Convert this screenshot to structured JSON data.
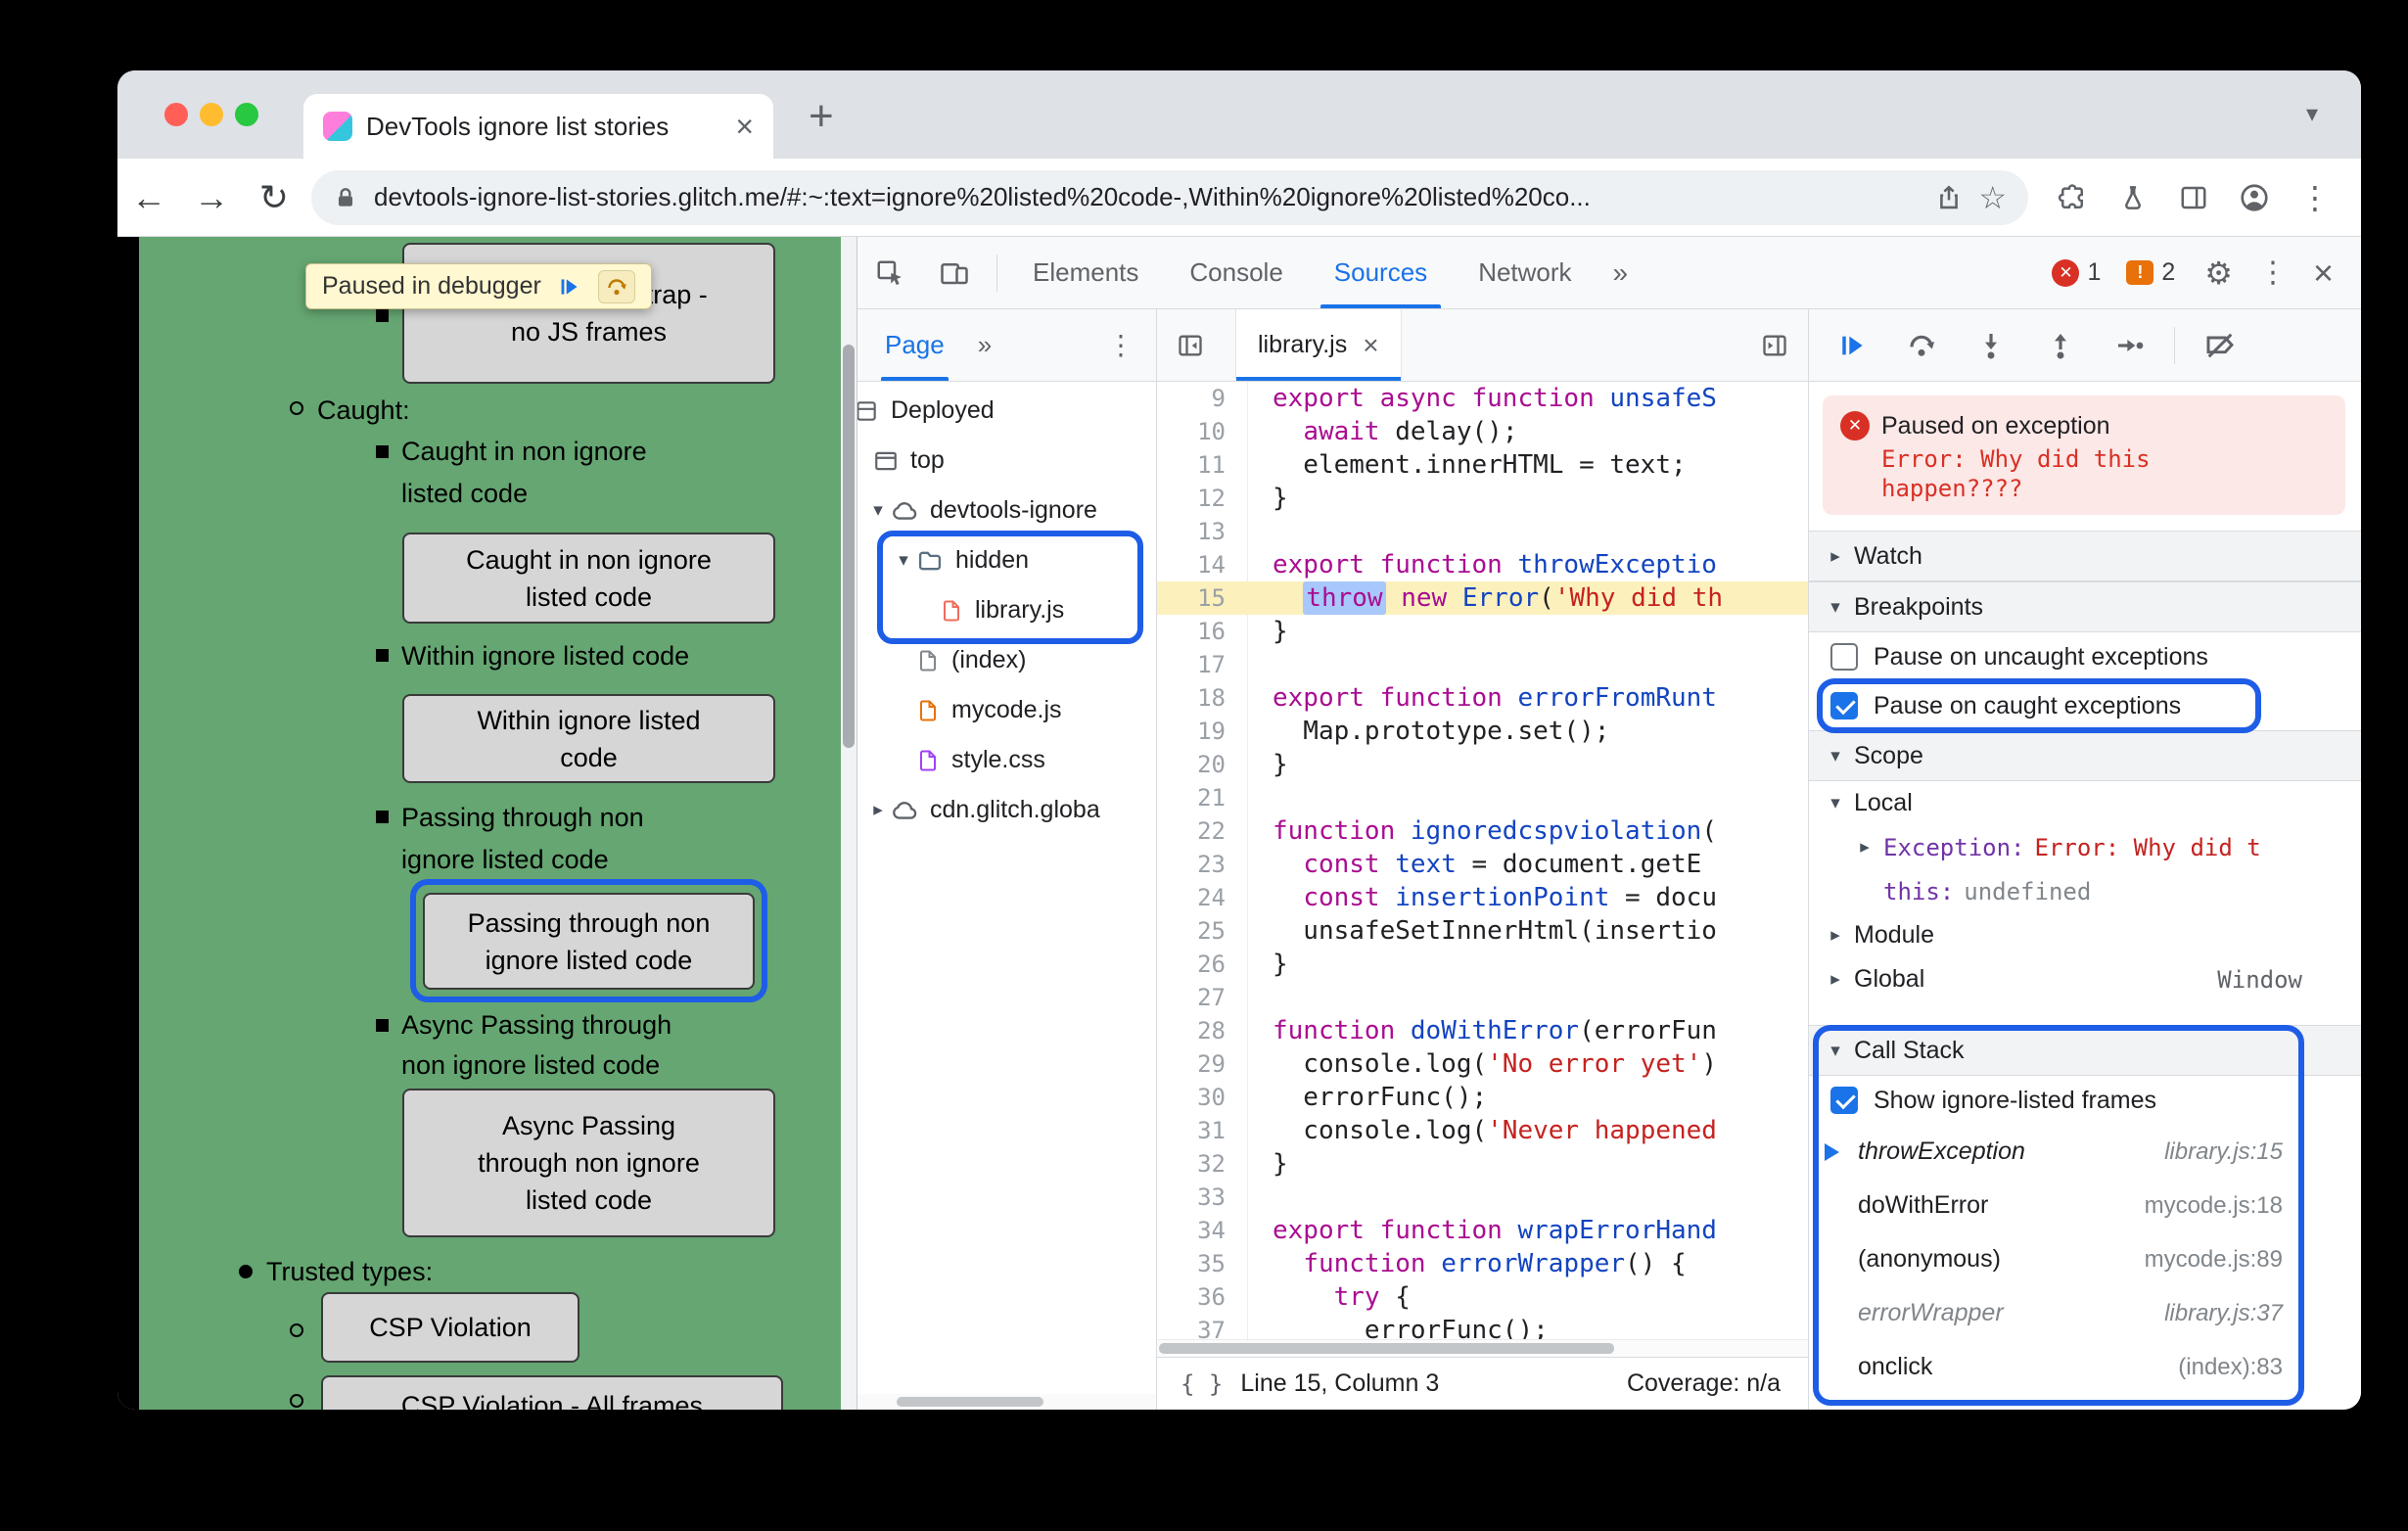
{
  "colors": {
    "accent_blue": "#1a73e8",
    "ring_blue": "#1e5de6",
    "page_green": "#65a672",
    "error_red": "#d93025",
    "keyword": "#a90d91",
    "definition": "#1344c0",
    "string_red": "#c5221f",
    "token_selection": "#a8c7fa",
    "exec_line_bg": "#fcf1bc"
  },
  "browser": {
    "tab_title": "DevTools ignore list stories",
    "url": "devtools-ignore-list-stories.glitch.me/#:~:text=ignore%20listed%20code-,Within%20ignore%20listed%20co..."
  },
  "page": {
    "banner_text": "Paused in debugger",
    "btn_wasm": "WebAssembly trap -\nno JS frames",
    "lbl_caught_heading": "Caught:",
    "lbl_caught": "Caught in non ignore\nlisted code",
    "btn_caught": "Caught in non ignore\nlisted code",
    "lbl_within": "Within ignore listed code",
    "btn_within": "Within ignore listed\ncode",
    "lbl_passing": "Passing through non\nignore listed code",
    "btn_passing": "Passing through non\nignore listed code",
    "lbl_async": "Async Passing through\nnon ignore listed code",
    "btn_async": "Async Passing\nthrough non ignore\nlisted code",
    "lbl_trusted": "Trusted types:",
    "btn_csp": "CSP Violation",
    "btn_csp_all": "CSP Violation - All frames"
  },
  "devtools": {
    "tabs": [
      "Elements",
      "Console",
      "Sources",
      "Network"
    ],
    "active_tab": "Sources",
    "error_count": "1",
    "issue_count": "2",
    "sources_panel": {
      "tab": "Page",
      "tree": [
        "Deployed",
        "top",
        "devtools-ignore",
        "hidden",
        "library.js",
        "(index)",
        "mycode.js",
        "style.css",
        "cdn.glitch.globa"
      ]
    },
    "editor": {
      "tab": "library.js",
      "status_position": "Line 15, Column 3",
      "status_coverage": "Coverage: n/a",
      "lines": [
        {
          "n": "9",
          "t": [
            [
              "k",
              "export async function"
            ],
            [
              "d",
              " unsafeS"
            ]
          ]
        },
        {
          "n": "10",
          "t": [
            [
              "p",
              "  "
            ],
            [
              "k",
              "await"
            ],
            [
              "p",
              " delay();"
            ]
          ]
        },
        {
          "n": "11",
          "t": [
            [
              "p",
              "  element.innerHTML = text;"
            ]
          ]
        },
        {
          "n": "12",
          "t": [
            [
              "p",
              "}"
            ]
          ]
        },
        {
          "n": "13",
          "t": []
        },
        {
          "n": "14",
          "t": [
            [
              "k",
              "export function"
            ],
            [
              "d",
              " throwExceptio"
            ]
          ]
        },
        {
          "n": "15",
          "exec": true,
          "t": [
            [
              "p",
              "  "
            ],
            [
              "kx",
              "throw"
            ],
            [
              "p",
              " "
            ],
            [
              "k",
              "new"
            ],
            [
              "p",
              " "
            ],
            [
              "d",
              "Error"
            ],
            [
              "p",
              "("
            ],
            [
              "s",
              "'Why did th"
            ]
          ]
        },
        {
          "n": "16",
          "t": [
            [
              "p",
              "}"
            ]
          ]
        },
        {
          "n": "17",
          "t": []
        },
        {
          "n": "18",
          "t": [
            [
              "k",
              "export function"
            ],
            [
              "d",
              " errorFromRunt"
            ]
          ]
        },
        {
          "n": "19",
          "t": [
            [
              "p",
              "  Map.prototype.set();"
            ]
          ]
        },
        {
          "n": "20",
          "t": [
            [
              "p",
              "}"
            ]
          ]
        },
        {
          "n": "21",
          "t": []
        },
        {
          "n": "22",
          "t": [
            [
              "k",
              "function"
            ],
            [
              "d",
              " ignoredcspviolation"
            ],
            [
              "p",
              "("
            ]
          ]
        },
        {
          "n": "23",
          "t": [
            [
              "p",
              "  "
            ],
            [
              "k",
              "const"
            ],
            [
              "p",
              " "
            ],
            [
              "d",
              "text"
            ],
            [
              "p",
              " = document.getE"
            ]
          ]
        },
        {
          "n": "24",
          "t": [
            [
              "p",
              "  "
            ],
            [
              "k",
              "const"
            ],
            [
              "p",
              " "
            ],
            [
              "d",
              "insertionPoint"
            ],
            [
              "p",
              " = docu"
            ]
          ]
        },
        {
          "n": "25",
          "t": [
            [
              "p",
              "  unsafeSetInnerHtml(insertio"
            ]
          ]
        },
        {
          "n": "26",
          "t": [
            [
              "p",
              "}"
            ]
          ]
        },
        {
          "n": "27",
          "t": []
        },
        {
          "n": "28",
          "t": [
            [
              "k",
              "function"
            ],
            [
              "d",
              " doWithError"
            ],
            [
              "p",
              "(errorFun"
            ]
          ]
        },
        {
          "n": "29",
          "t": [
            [
              "p",
              "  console.log("
            ],
            [
              "s",
              "'No error yet'"
            ],
            [
              "p",
              ")"
            ]
          ]
        },
        {
          "n": "30",
          "t": [
            [
              "p",
              "  errorFunc();"
            ]
          ]
        },
        {
          "n": "31",
          "t": [
            [
              "p",
              "  console.log("
            ],
            [
              "s",
              "'Never happened"
            ]
          ]
        },
        {
          "n": "32",
          "t": [
            [
              "p",
              "}"
            ]
          ]
        },
        {
          "n": "33",
          "t": []
        },
        {
          "n": "34",
          "t": [
            [
              "k",
              "export function"
            ],
            [
              "d",
              " wrapErrorHand"
            ]
          ]
        },
        {
          "n": "35",
          "t": [
            [
              "p",
              "  "
            ],
            [
              "k",
              "function"
            ],
            [
              "d",
              " errorWrapper"
            ],
            [
              "p",
              "() {"
            ]
          ]
        },
        {
          "n": "36",
          "t": [
            [
              "p",
              "    "
            ],
            [
              "k",
              "try"
            ],
            [
              "p",
              " {"
            ]
          ]
        },
        {
          "n": "37",
          "t": [
            [
              "p",
              "      errorFunc();"
            ]
          ]
        }
      ]
    },
    "debugger": {
      "paused_title": "Paused on exception",
      "paused_message": "Error: Why did this happen????",
      "watch": "Watch",
      "breakpoints": "Breakpoints",
      "bp_items": [
        {
          "label": "Pause on uncaught exceptions",
          "checked": false
        },
        {
          "label": "Pause on caught exceptions",
          "checked": true
        }
      ],
      "scope": "Scope",
      "scope_local": "Local",
      "scope_rows": {
        "exception_name": "Exception:",
        "exception_value": "Error: Why did t",
        "this_name": "this:",
        "this_value": "undefined",
        "module": "Module",
        "global": "Global",
        "global_value": "Window"
      },
      "callstack": "Call Stack",
      "show_ignore_listed": "Show ignore-listed frames",
      "show_ignore_listed_checked": true,
      "frames": [
        {
          "name": "throwException",
          "loc": "library.js:15",
          "current": true,
          "ignored": true
        },
        {
          "name": "doWithError",
          "loc": "mycode.js:18",
          "current": false,
          "ignored": false
        },
        {
          "name": "(anonymous)",
          "loc": "mycode.js:89",
          "current": false,
          "ignored": false
        },
        {
          "name": "errorWrapper",
          "loc": "library.js:37",
          "current": false,
          "ignored": true
        },
        {
          "name": "onclick",
          "loc": "(index):83",
          "current": false,
          "ignored": false
        }
      ]
    }
  }
}
